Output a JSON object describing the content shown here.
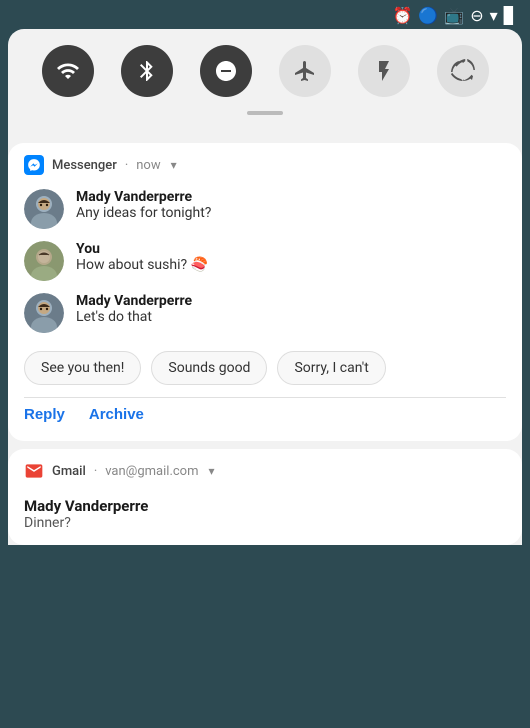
{
  "statusBar": {
    "icons": [
      "alarm",
      "bluetooth",
      "cast",
      "minus-circle",
      "wifi",
      "signal"
    ]
  },
  "quickSettings": {
    "buttons": [
      {
        "id": "wifi",
        "label": "WiFi",
        "symbol": "▾",
        "active": true
      },
      {
        "id": "bluetooth",
        "label": "Bluetooth",
        "symbol": "⬡",
        "active": true
      },
      {
        "id": "dnd",
        "label": "Do Not Disturb",
        "symbol": "⊖",
        "active": true
      },
      {
        "id": "airplane",
        "label": "Airplane Mode",
        "symbol": "✈",
        "active": false
      },
      {
        "id": "flashlight",
        "label": "Flashlight",
        "symbol": "🔦",
        "active": false
      },
      {
        "id": "rotate",
        "label": "Auto Rotate",
        "symbol": "⟳",
        "active": false
      }
    ]
  },
  "messengerNotification": {
    "appName": "Messenger",
    "time": "now",
    "chevron": "▾",
    "messages": [
      {
        "sender": "Mady Vanderperre",
        "text": "Any ideas for tonight?",
        "avatarType": "mady"
      },
      {
        "sender": "You",
        "text": "How about sushi? 🍣",
        "avatarType": "you"
      },
      {
        "sender": "Mady Vanderperre",
        "text": "Let's do that",
        "avatarType": "mady"
      }
    ],
    "quickReplies": [
      {
        "id": "see-you-then",
        "label": "See you then!"
      },
      {
        "id": "sounds-good",
        "label": "Sounds good"
      },
      {
        "id": "sorry-cant",
        "label": "Sorry, I can't"
      }
    ],
    "actions": [
      {
        "id": "reply",
        "label": "Reply"
      },
      {
        "id": "archive",
        "label": "Archive"
      }
    ]
  },
  "gmailNotification": {
    "appName": "Gmail",
    "account": "van@gmail.com",
    "chevron": "▾",
    "sender": "Mady Vanderperre",
    "subject": "Dinner?"
  }
}
